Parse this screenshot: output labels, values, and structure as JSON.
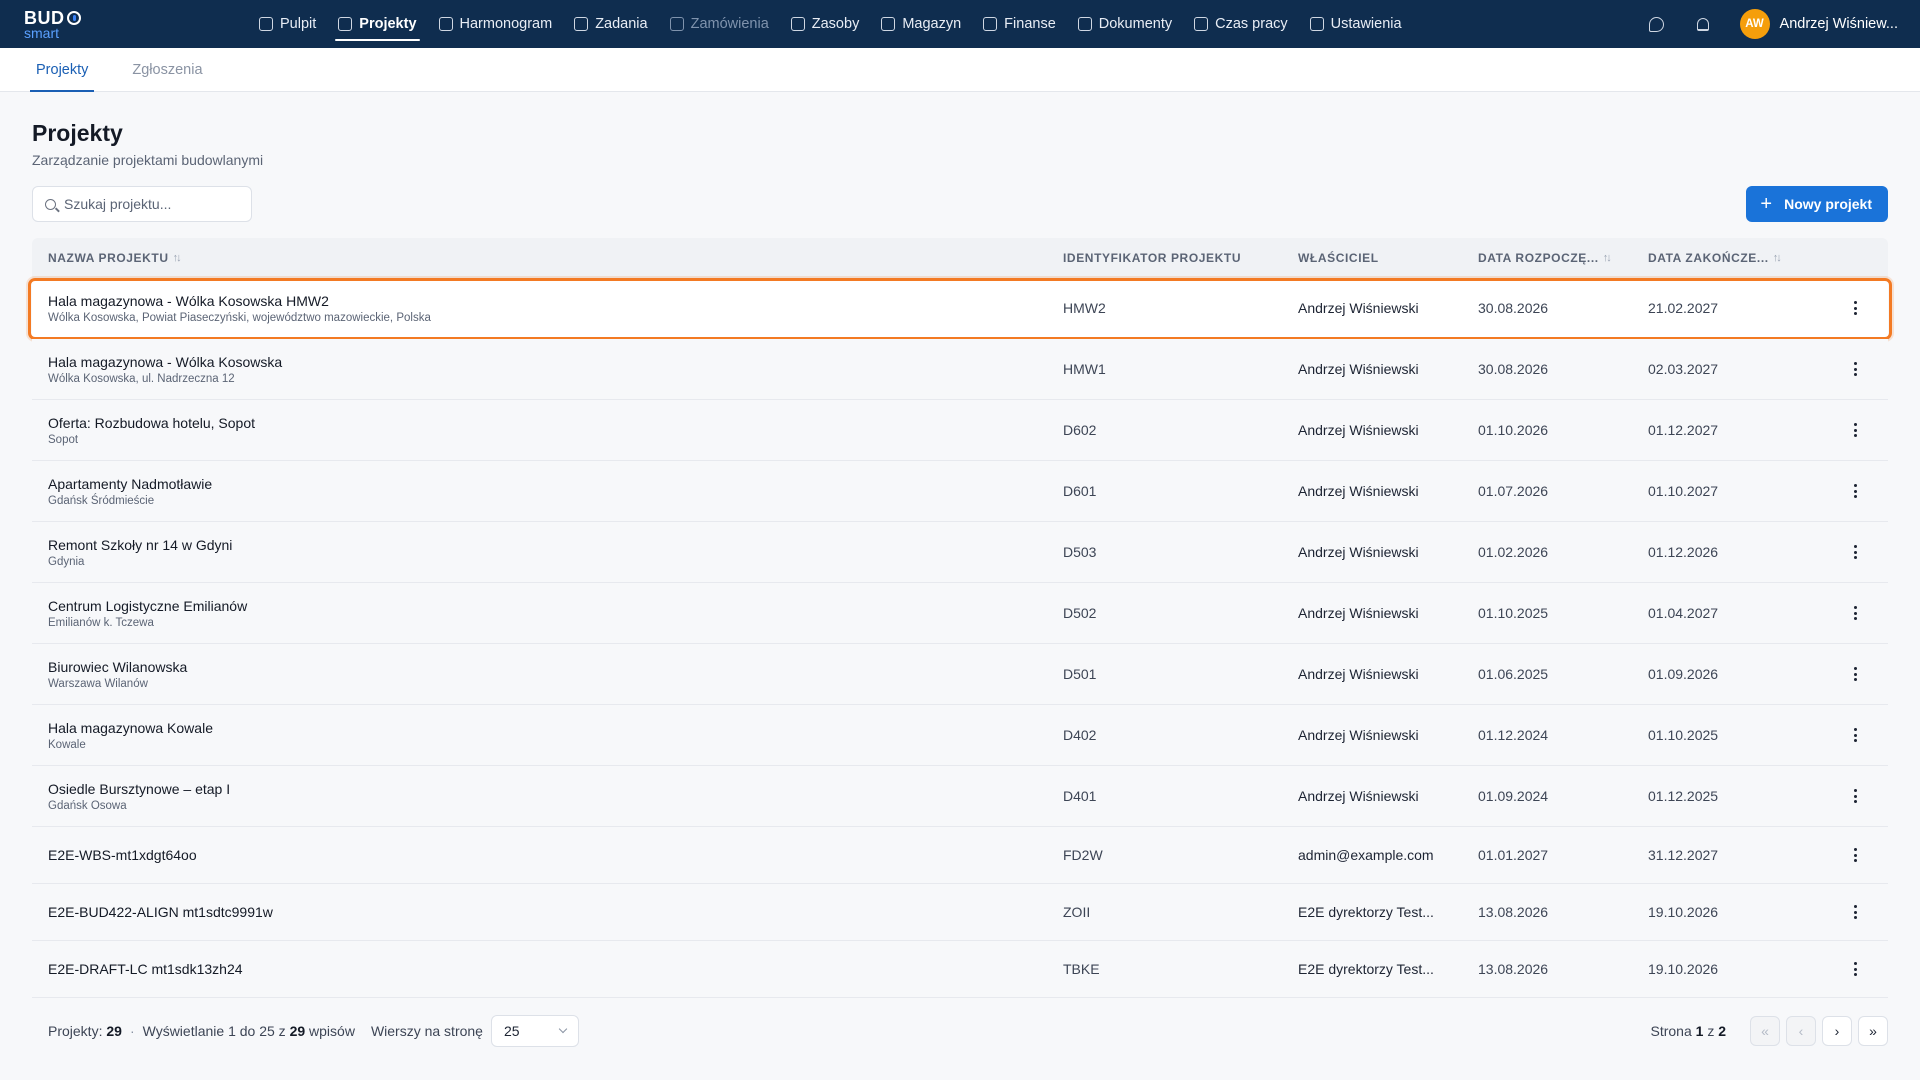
{
  "app": {
    "logo_main": "BUD",
    "logo_sub": "smart"
  },
  "nav": [
    {
      "label": "Pulpit",
      "icon": "home-icon",
      "state": "normal"
    },
    {
      "label": "Projekty",
      "icon": "folder-icon",
      "state": "active"
    },
    {
      "label": "Harmonogram",
      "icon": "calendar-icon",
      "state": "normal"
    },
    {
      "label": "Zadania",
      "icon": "clipboard-icon",
      "state": "normal"
    },
    {
      "label": "Zamówienia",
      "icon": "package-icon",
      "state": "disabled"
    },
    {
      "label": "Zasoby",
      "icon": "layers-icon",
      "state": "normal"
    },
    {
      "label": "Magazyn",
      "icon": "warehouse-icon",
      "state": "normal"
    },
    {
      "label": "Finanse",
      "icon": "wallet-icon",
      "state": "normal"
    },
    {
      "label": "Dokumenty",
      "icon": "document-icon",
      "state": "normal"
    },
    {
      "label": "Czas pracy",
      "icon": "clock-icon",
      "state": "normal"
    },
    {
      "label": "Ustawienia",
      "icon": "gear-icon",
      "state": "normal"
    }
  ],
  "user": {
    "initials": "AW",
    "name": "Andrzej Wiśniew...",
    "avatar_color": "#f59e0b"
  },
  "subtabs": [
    {
      "label": "Projekty",
      "active": true
    },
    {
      "label": "Zgłoszenia",
      "active": false
    }
  ],
  "page": {
    "title": "Projekty",
    "subtitle": "Zarządzanie projektami budowlanymi"
  },
  "search": {
    "placeholder": "Szukaj projektu...",
    "value": ""
  },
  "new_project_label": "Nowy projekt",
  "table": {
    "headers": {
      "name": "NAZWA PROJEKTU",
      "id": "IDENTYFIKATOR PROJEKTU",
      "owner": "WŁAŚCICIEL",
      "start": "DATA ROZPOCZĘ...",
      "end": "DATA ZAKOŃCZE..."
    },
    "rows": [
      {
        "name": "Hala magazynowa - Wólka Kosowska HMW2",
        "location": "Wólka Kosowska, Powiat Piaseczyński, województwo mazowieckie, Polska",
        "id": "HMW2",
        "owner": "Andrzej Wiśniewski",
        "start": "30.08.2026",
        "end": "21.02.2027",
        "selected": true
      },
      {
        "name": "Hala magazynowa - Wólka Kosowska",
        "location": "Wólka Kosowska, ul. Nadrzeczna 12",
        "id": "HMW1",
        "owner": "Andrzej Wiśniewski",
        "start": "30.08.2026",
        "end": "02.03.2027"
      },
      {
        "name": "Oferta: Rozbudowa hotelu, Sopot",
        "location": "Sopot",
        "id": "D602",
        "owner": "Andrzej Wiśniewski",
        "start": "01.10.2026",
        "end": "01.12.2027"
      },
      {
        "name": "Apartamenty Nadmotławie",
        "location": "Gdańsk Śródmieście",
        "id": "D601",
        "owner": "Andrzej Wiśniewski",
        "start": "01.07.2026",
        "end": "01.10.2027"
      },
      {
        "name": "Remont Szkoły nr 14 w Gdyni",
        "location": "Gdynia",
        "id": "D503",
        "owner": "Andrzej Wiśniewski",
        "start": "01.02.2026",
        "end": "01.12.2026"
      },
      {
        "name": "Centrum Logistyczne Emilianów",
        "location": "Emilianów k. Tczewa",
        "id": "D502",
        "owner": "Andrzej Wiśniewski",
        "start": "01.10.2025",
        "end": "01.04.2027"
      },
      {
        "name": "Biurowiec Wilanowska",
        "location": "Warszawa Wilanów",
        "id": "D501",
        "owner": "Andrzej Wiśniewski",
        "start": "01.06.2025",
        "end": "01.09.2026"
      },
      {
        "name": "Hala magazynowa Kowale",
        "location": "Kowale",
        "id": "D402",
        "owner": "Andrzej Wiśniewski",
        "start": "01.12.2024",
        "end": "01.10.2025"
      },
      {
        "name": "Osiedle Bursztynowe – etap I",
        "location": "Gdańsk Osowa",
        "id": "D401",
        "owner": "Andrzej Wiśniewski",
        "start": "01.09.2024",
        "end": "01.12.2025"
      },
      {
        "name": "E2E-WBS-mt1xdgt64oo",
        "location": "",
        "id": "FD2W",
        "owner": "admin@example.com",
        "start": "01.01.2027",
        "end": "31.12.2027"
      },
      {
        "name": "E2E-BUD422-ALIGN mt1sdtc9991w",
        "location": "",
        "id": "ZOII",
        "owner": "E2E dyrektorzy Test...",
        "start": "13.08.2026",
        "end": "19.10.2026"
      },
      {
        "name": "E2E-DRAFT-LC mt1sdk13zh24",
        "location": "",
        "id": "TBKE",
        "owner": "E2E dyrektorzy Test...",
        "start": "13.08.2026",
        "end": "19.10.2026"
      }
    ]
  },
  "footer": {
    "projects_label": "Projekty:",
    "projects_count": "29",
    "showing_prefix": "Wyświetlanie 1 do 25 z",
    "showing_total": "29",
    "showing_suffix": "wpisów",
    "per_page_label": "Wierszy na stronę",
    "per_page_value": "25",
    "page_prefix": "Strona",
    "page_current": "1",
    "page_sep": "z",
    "page_total": "2"
  },
  "colors": {
    "topbar": "#0f2d4f",
    "accent": "#1a73d9",
    "selection_outline": "#f37a23"
  }
}
